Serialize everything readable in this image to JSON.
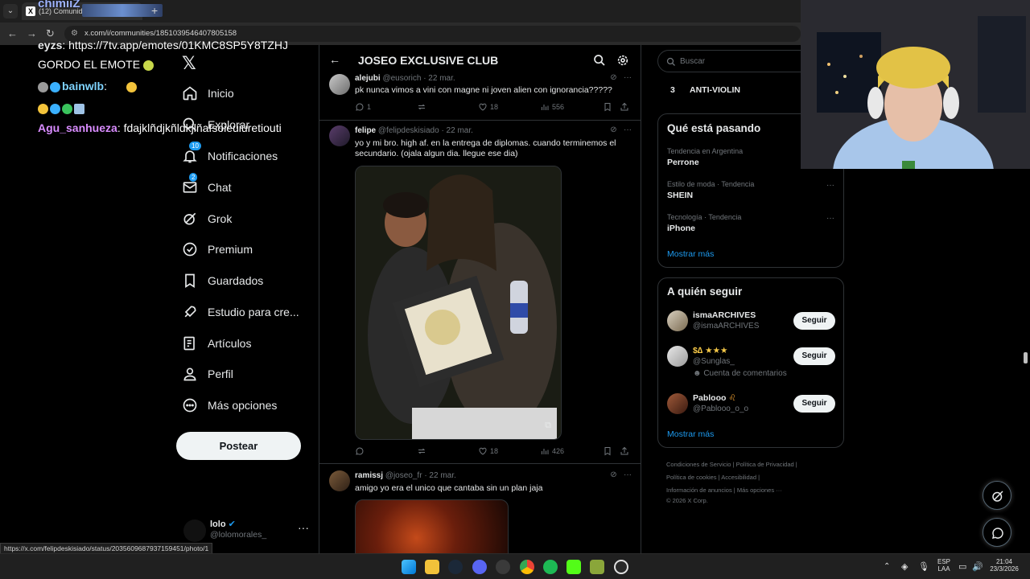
{
  "browser": {
    "tab_title": "(12) Comunidad",
    "url": "x.com/i/communities/1851039546407805158",
    "status_url": "https://x.com/felipdeskisiado/status/2035609687937159451/photo/1"
  },
  "chat": [
    {
      "user": "chimiiZ",
      "text": ""
    },
    {
      "user": "eyzs",
      "text": "https://7tv.app/emotes/01KMC8SP5Y8TZHJ"
    },
    {
      "user": "",
      "text": "GORDO EL EMOTE"
    },
    {
      "user": "bainwlb",
      "text": ""
    },
    {
      "user": "Agu_sanhueza",
      "text": "fdajklñdjkñldkjlñafsoieuiuretiouti"
    }
  ],
  "sidebar": {
    "items": [
      {
        "label": "Inicio",
        "icon": "home-icon"
      },
      {
        "label": "Explorar",
        "icon": "search-icon"
      },
      {
        "label": "Notificaciones",
        "icon": "bell-icon",
        "badge": "10"
      },
      {
        "label": "Chat",
        "icon": "mail-icon",
        "badge": "2"
      },
      {
        "label": "Grok",
        "icon": "grok-icon"
      },
      {
        "label": "Premium",
        "icon": "verified-icon"
      },
      {
        "label": "Guardados",
        "icon": "bookmark-icon"
      },
      {
        "label": "Estudio para cre...",
        "icon": "rocket-icon"
      },
      {
        "label": "Artículos",
        "icon": "article-icon"
      },
      {
        "label": "Perfil",
        "icon": "person-icon"
      },
      {
        "label": "Más opciones",
        "icon": "more-circle-icon"
      }
    ],
    "post_label": "Postear",
    "profile_name": "lolo",
    "profile_handle": "@lolomorales_"
  },
  "community": {
    "title": "JOSEO EXCLUSIVE CLUB"
  },
  "posts": [
    {
      "user": "alejubi",
      "handle": "@eusorich",
      "date": "· 22 mar.",
      "text": "pk nunca vimos a vini con magne ni joven alien con ignorancia?????",
      "replies": "1",
      "reposts": "",
      "likes": "18",
      "views": "556"
    },
    {
      "user": "felipe",
      "handle": "@felipdeskisiado",
      "date": "· 22 mar.",
      "text": "yo y mi bro. high af. en la entrega de diplomas. cuando terminemos el secundario. (ojala algun dia. llegue ese dia)",
      "replies": "",
      "reposts": "",
      "likes": "18",
      "views": "426"
    },
    {
      "user": "ramissj",
      "handle": "@joseo_fr",
      "date": "· 22 mar.",
      "text": "amigo yo era el unico que cantaba sin un plan jaja"
    }
  ],
  "right": {
    "search_placeholder": "Buscar",
    "pinned_num": "3",
    "pinned_name": "ANTI-VIOLIN",
    "trends_title": "Qué está pasando",
    "trends": [
      {
        "category": "Tendencia en Argentina",
        "name": "Perrone"
      },
      {
        "category": "Estilo de moda · Tendencia",
        "name": "SHEIN"
      },
      {
        "category": "Tecnología · Tendencia",
        "name": "iPhone"
      }
    ],
    "show_more": "Mostrar más",
    "follow_title": "A quién seguir",
    "follow": [
      {
        "name": "ismaARCHIVES",
        "handle": "@ismaARCHIVES",
        "sub": ""
      },
      {
        "name": "$∆ ★★★",
        "handle": "@Sunglas_",
        "sub": "Cuenta de comentarios"
      },
      {
        "name": "Pablooo",
        "handle": "@Pablooo_o_o",
        "sub": ""
      }
    ],
    "follow_label": "Seguir",
    "footer": [
      "Condiciones de Servicio  |  Política de Privacidad  |",
      "Política de cookies  |  Accesibilidad  |",
      "Información de anuncios  |  Más opciones ···",
      "© 2026 X Corp."
    ]
  },
  "taskbar": {
    "lang1": "ESP",
    "lang2": "LAA",
    "time": "21:04",
    "date": "23/3/2026"
  },
  "colors": {
    "accent": "#1d9bf0",
    "background": "#000000",
    "border": "#2f3336",
    "muted": "#71767b"
  }
}
